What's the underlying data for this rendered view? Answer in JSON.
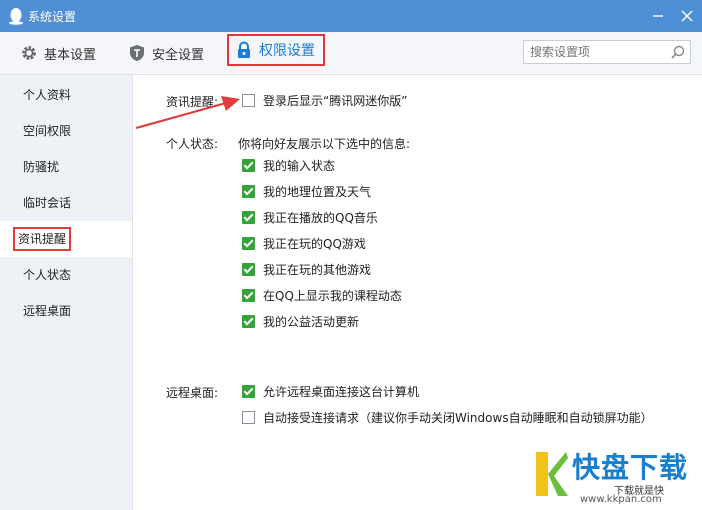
{
  "window": {
    "title": "系统设置"
  },
  "tabs": [
    {
      "label": "基本设置",
      "icon": "gear-icon"
    },
    {
      "label": "安全设置",
      "icon": "shield-icon"
    },
    {
      "label": "权限设置",
      "icon": "lock-icon",
      "active": true
    }
  ],
  "search": {
    "placeholder": "搜索设置项"
  },
  "sidebar": {
    "items": [
      {
        "label": "个人资料"
      },
      {
        "label": "空间权限"
      },
      {
        "label": "防骚扰"
      },
      {
        "label": "临时会话"
      },
      {
        "label": "资讯提醒",
        "active": true
      },
      {
        "label": "个人状态"
      },
      {
        "label": "远程桌面"
      }
    ]
  },
  "news": {
    "label": "资讯提醒:",
    "option": {
      "label": "登录后显示“腾讯网迷你版”",
      "checked": false
    }
  },
  "status": {
    "label": "个人状态:",
    "intro": "你将向好友展示以下选中的信息:",
    "options": [
      {
        "label": "我的输入状态",
        "checked": true
      },
      {
        "label": "我的地理位置及天气",
        "checked": true
      },
      {
        "label": "我正在播放的QQ音乐",
        "checked": true
      },
      {
        "label": "我正在玩的QQ游戏",
        "checked": true
      },
      {
        "label": "我正在玩的其他游戏",
        "checked": true
      },
      {
        "label": "在QQ上显示我的课程动态",
        "checked": true
      },
      {
        "label": "我的公益活动更新",
        "checked": true
      }
    ]
  },
  "remote": {
    "label": "远程桌面:",
    "options": [
      {
        "label": "允许远程桌面连接这台计算机",
        "checked": true
      },
      {
        "label": "自动接受连接请求（建议你手动关闭Windows自动睡眠和自动锁屏功能）",
        "checked": false
      }
    ]
  },
  "watermark": {
    "brand": "快盘下载",
    "slogan": "下载就是快",
    "url": "www.kkpan.com"
  },
  "colors": {
    "titlebar": "#4f8fd5",
    "accent": "#1d7cd6",
    "check": "#35a33a",
    "highlight": "#e33b3b"
  }
}
